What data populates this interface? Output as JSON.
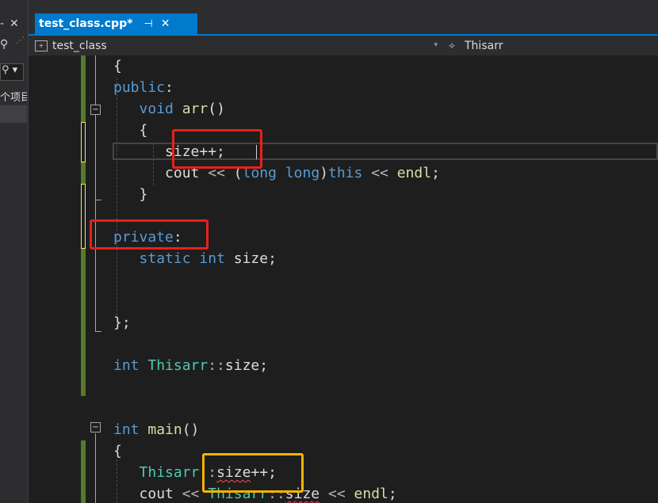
{
  "left_panel": {
    "glyphs": [
      "-",
      "✕",
      "⚲",
      "⋰"
    ],
    "search_glyph": "⚲ ▾",
    "project_text": "个项目"
  },
  "tab": {
    "title": "test_class.cpp*",
    "pin_glyph": "⊣",
    "close_glyph": "✕"
  },
  "nav": {
    "scope": "test_class",
    "scope_icon": "class-icon",
    "member": "Thisarr",
    "member_icon": "class-member-icon",
    "dropdown_arrow": "▾"
  },
  "code": {
    "brace_open": "{",
    "public_kw": "public",
    "colon": ":",
    "void_kw": "void",
    "arr_fn": "arr",
    "parens": "()",
    "size_inc_stmt": "size++;",
    "cout": "cout",
    "shift": "<<",
    "long_kw": "long",
    "this_kw": "this",
    "endl": "endl",
    "semicolon": ";",
    "brace_close": "}",
    "private_kw": "private",
    "static_kw": "static",
    "int_kw": "int",
    "size_id": "size",
    "class_end": "};",
    "thisarr_type": "Thisarr",
    "scope_op": "::",
    "main_fn": "main",
    "size_inc_op": "++",
    "fold_glyph": "−"
  },
  "colors": {
    "keyword": "#569cd6",
    "type": "#4ec9b0",
    "function": "#dcdcaa",
    "annotation_red": "#e8211b",
    "annotation_orange": "#f5b300",
    "tab_accent": "#007acc",
    "changes_saved": "#57792b",
    "changes_unsaved": "#efe86a"
  }
}
